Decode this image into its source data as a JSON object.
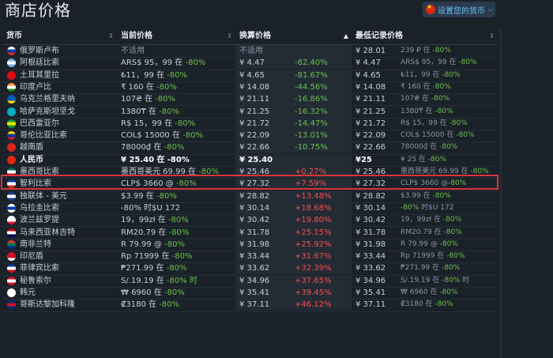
{
  "page": {
    "title": "商店价格",
    "currency_button": "设置您的货币"
  },
  "columns": [
    {
      "label": "货币",
      "sort": "⇕"
    },
    {
      "label": "当前价格",
      "sort": "⇕"
    },
    {
      "label": "换算价格",
      "sort": "▲"
    },
    {
      "label": "最低记录价格",
      "sort": "⇕"
    }
  ],
  "rows": [
    {
      "flag": "ru",
      "name": "俄罗斯卢布",
      "current": "不适用",
      "current_na": true,
      "conv": "不适用",
      "conv_na": true,
      "pct": "",
      "pct_type": "",
      "lowconv": "¥ 28.01",
      "low": "239 ₽ 在 -80%"
    },
    {
      "flag": "ar",
      "name": "阿根廷比索",
      "current": "ARS$ 95，99 在",
      "cur_disc": "-80%",
      "conv": "¥ 4.47",
      "pct": "-82.40%",
      "pct_type": "g",
      "lowconv": "¥ 4.47",
      "low": "ARS$ 95，99 在 -80%"
    },
    {
      "flag": "tr",
      "name": "土耳其里拉",
      "current": "₺11，99 在",
      "cur_disc": "-80%",
      "conv": "¥ 4.65",
      "pct": "-81.67%",
      "pct_type": "g",
      "lowconv": "¥ 4.65",
      "low": "₺11，99 在 -80%"
    },
    {
      "flag": "in",
      "name": "印度卢比",
      "current": "₹ 160 在",
      "cur_disc": "-80%",
      "conv": "¥ 14.08",
      "pct": "-44.56%",
      "pct_type": "g",
      "lowconv": "¥ 14.08",
      "low": "₹ 160 在 -80%"
    },
    {
      "flag": "ua",
      "name": "乌克兰格里夫纳",
      "current": "107₴ 在",
      "cur_disc": "-80%",
      "conv": "¥ 21.11",
      "pct": "-16.86%",
      "pct_type": "g",
      "lowconv": "¥ 21.11",
      "low": "107₴ 在 -80%"
    },
    {
      "flag": "kz",
      "name": "哈萨克斯坦坚戈",
      "current": "1380₸ 在",
      "cur_disc": "-80%",
      "conv": "¥ 21.25",
      "pct": "-16.32%",
      "pct_type": "g",
      "lowconv": "¥ 21.25",
      "low": "1380₸ 在 -80%"
    },
    {
      "flag": "br",
      "name": "巴西雷亚尔",
      "current": "R$ 15，99 在",
      "cur_disc": "-80%",
      "conv": "¥ 21.72",
      "pct": "-14.47%",
      "pct_type": "g",
      "lowconv": "¥ 21.72",
      "low": "R$ 15，99 在 -80%"
    },
    {
      "flag": "co",
      "name": "哥伦比亚比索",
      "current": "COL$ 15000 在",
      "cur_disc": "-80%",
      "conv": "¥ 22.09",
      "pct": "-13.01%",
      "pct_type": "g",
      "lowconv": "¥ 22.09",
      "low": "COL$ 15000 在 -80%"
    },
    {
      "flag": "vn",
      "name": "越南盾",
      "current": "78000₫ 在",
      "cur_disc": "-80%",
      "conv": "¥ 22.66",
      "pct": "-10.75%",
      "pct_type": "g",
      "lowconv": "¥ 22.66",
      "low": "78000₫ 在 -80%"
    },
    {
      "flag": "cn",
      "name": "人民币",
      "current": "¥ 25.40 在",
      "cur_disc": "-80%",
      "conv": "¥ 25.40",
      "pct": "",
      "pct_type": "",
      "lowconv": "¥25",
      "low": "¥ 25 在 -80%",
      "highlight": true
    },
    {
      "flag": "mx",
      "name": "墨西哥比索",
      "current": "墨西哥美元 69.99 在",
      "cur_disc": "-80%",
      "conv": "¥ 25.46",
      "pct": "+0.27%",
      "pct_type": "r",
      "lowconv": "¥ 25.46",
      "low": "墨西哥美元 69.99 在 -80%"
    },
    {
      "flag": "cl",
      "name": "智利比索",
      "current": "CLP$ 3660 @",
      "cur_disc": "-80%",
      "conv": "¥ 27.32",
      "pct": "+7.59%",
      "pct_type": "r",
      "lowconv": "¥ 27.32",
      "low": "CLP$ 3660 @-80%"
    },
    {
      "flag": "cis",
      "name": "独联体 - 美元",
      "current": "$3.99 在",
      "cur_disc": "-80%",
      "conv": "¥ 28.82",
      "pct": "+13.48%",
      "pct_type": "r",
      "lowconv": "¥ 28.82",
      "low": "$3.99 在 -80%"
    },
    {
      "flag": "uy",
      "name": "乌拉圭比索",
      "current": "-80% 时$U 172",
      "cur_disc": "",
      "conv": "¥ 30.14",
      "pct": "+18.68%",
      "pct_type": "r",
      "lowconv": "¥ 30.14",
      "low": "-80% 时$U 172"
    },
    {
      "flag": "pl",
      "name": "波兰兹罗提",
      "current": "19，99zł 在",
      "cur_disc": "-80%",
      "conv": "¥ 30.42",
      "pct": "+19.80%",
      "pct_type": "r",
      "lowconv": "¥ 30.42",
      "low": "19，99zł 在 -80%"
    },
    {
      "flag": "my",
      "name": "马来西亚林吉特",
      "current": "RM20.79 在",
      "cur_disc": "-80%",
      "conv": "¥ 31.78",
      "pct": "+25.15%",
      "pct_type": "r",
      "lowconv": "¥ 31.78",
      "low": "RM20.79 在 -80%"
    },
    {
      "flag": "za",
      "name": "南非兰特",
      "current": "R 79.99 @",
      "cur_disc": "-80%",
      "conv": "¥ 31.98",
      "pct": "+25.92%",
      "pct_type": "r",
      "lowconv": "¥ 31.98",
      "low": "R 79.99 @ -80%"
    },
    {
      "flag": "id",
      "name": "印尼盾",
      "current": "Rp 71999 在",
      "cur_disc": "-80%",
      "conv": "¥ 33.44",
      "pct": "+31.67%",
      "pct_type": "r",
      "lowconv": "¥ 33.44",
      "low": "Rp 71999 在 -80%"
    },
    {
      "flag": "ph",
      "name": "菲律宾比索",
      "current": "₱271.99 在",
      "cur_disc": "-80%",
      "conv": "¥ 33.62",
      "pct": "+32.39%",
      "pct_type": "r",
      "lowconv": "¥ 33.62",
      "low": "₱271.99 在 -80%"
    },
    {
      "flag": "pe",
      "name": "秘鲁索尔",
      "current": "S/.19.19 在",
      "cur_disc": "-80% 时",
      "conv": "¥ 34.96",
      "pct": "+37.65%",
      "pct_type": "r",
      "lowconv": "¥ 34.96",
      "low": "S/.19.19 在 -80% 时"
    },
    {
      "flag": "kr",
      "name": "韩元",
      "current": "₩ 6960 在",
      "cur_disc": "-80%",
      "conv": "¥ 35.41",
      "pct": "+39.45%",
      "pct_type": "r",
      "lowconv": "¥ 35.41",
      "low": "₩ 6960 在 -80%"
    },
    {
      "flag": "cr",
      "name": "哥斯达黎加科隆",
      "current": "₡3180 在",
      "cur_disc": "-80%",
      "conv": "¥ 37.11",
      "pct": "+46.12%",
      "pct_type": "r",
      "lowconv": "¥ 37.11",
      "low": "₡3180 在 -80%"
    }
  ],
  "flag_colors": {
    "ru": [
      "#ffffff",
      "#0039a6",
      "#d52b1e"
    ],
    "ar": [
      "#74acdf",
      "#ffffff",
      "#74acdf"
    ],
    "tr": [
      "#e30a17",
      "#e30a17",
      "#e30a17"
    ],
    "in": [
      "#ff9933",
      "#ffffff",
      "#138808"
    ],
    "ua": [
      "#0057b7",
      "#0057b7",
      "#ffd700"
    ],
    "kz": [
      "#00afca",
      "#00afca",
      "#00afca"
    ],
    "br": [
      "#009c3b",
      "#ffdf00",
      "#009c3b"
    ],
    "co": [
      "#fcd116",
      "#003893",
      "#ce1126"
    ],
    "vn": [
      "#da251d",
      "#da251d",
      "#da251d"
    ],
    "cn": [
      "#de2910",
      "#de2910",
      "#de2910"
    ],
    "mx": [
      "#006847",
      "#ffffff",
      "#ce1126"
    ],
    "cl": [
      "#0039a6",
      "#ffffff",
      "#d52b1e"
    ],
    "cis": [
      "#1d3b8c",
      "#ffffff",
      "#1d3b8c"
    ],
    "uy": [
      "#ffffff",
      "#0038a8",
      "#ffffff"
    ],
    "pl": [
      "#ffffff",
      "#ffffff",
      "#dc143c"
    ],
    "my": [
      "#cc0001",
      "#ffffff",
      "#010066"
    ],
    "za": [
      "#de3831",
      "#007a4d",
      "#002395"
    ],
    "id": [
      "#ce1126",
      "#ce1126",
      "#ffffff"
    ],
    "ph": [
      "#0038a8",
      "#ffffff",
      "#ce1126"
    ],
    "pe": [
      "#d91023",
      "#ffffff",
      "#d91023"
    ],
    "kr": [
      "#ffffff",
      "#ffffff",
      "#ffffff"
    ],
    "cr": [
      "#002b7f",
      "#ce1126",
      "#002b7f"
    ]
  }
}
